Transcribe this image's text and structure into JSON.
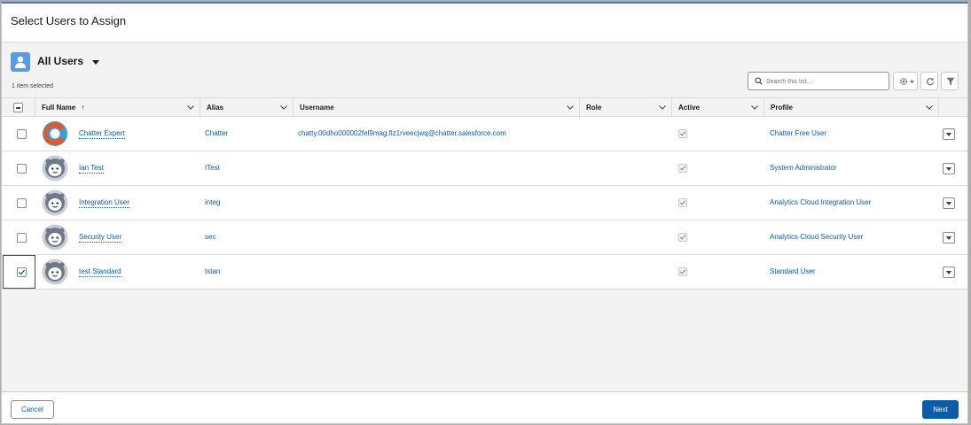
{
  "dialog": {
    "title": "Select Users to Assign"
  },
  "list": {
    "title": "All Users",
    "selection_count": "1 item selected",
    "search_placeholder": "Search this list...",
    "icon": "user-icon"
  },
  "columns": {
    "full_name": "Full Name",
    "sort_indicator": "↑",
    "alias": "Alias",
    "username": "Username",
    "role": "Role",
    "active": "Active",
    "profile": "Profile"
  },
  "rows": [
    {
      "full_name": "Chatter Expert",
      "alias": "Chatter",
      "username": "chatty.00dho000002fel9mag.flz1rveecjwq@chatter.salesforce.com",
      "role": "",
      "active": true,
      "profile": "Chatter Free User",
      "selected": false,
      "avatar": "chatter-logo"
    },
    {
      "full_name": "Ian Test",
      "alias": "ITest",
      "username": "",
      "role": "",
      "active": true,
      "profile": "System Administrator",
      "selected": false,
      "avatar": "astro"
    },
    {
      "full_name": "Integration User",
      "alias": "integ",
      "username": "",
      "role": "",
      "active": true,
      "profile": "Analytics Cloud Integration User",
      "selected": false,
      "avatar": "astro"
    },
    {
      "full_name": "Security User",
      "alias": "sec",
      "username": "",
      "role": "",
      "active": true,
      "profile": "Analytics Cloud Security User",
      "selected": false,
      "avatar": "astro"
    },
    {
      "full_name": "test Standard",
      "alias": "tstan",
      "username": "",
      "role": "",
      "active": true,
      "profile": "Standard User",
      "selected": true,
      "avatar": "astro"
    }
  ],
  "footer": {
    "cancel_label": "Cancel",
    "next_label": "Next"
  },
  "colors": {
    "brand_blue": "#0b5cab",
    "link_blue": "#0b5cab",
    "list_icon_blue": "#5a9be8"
  }
}
